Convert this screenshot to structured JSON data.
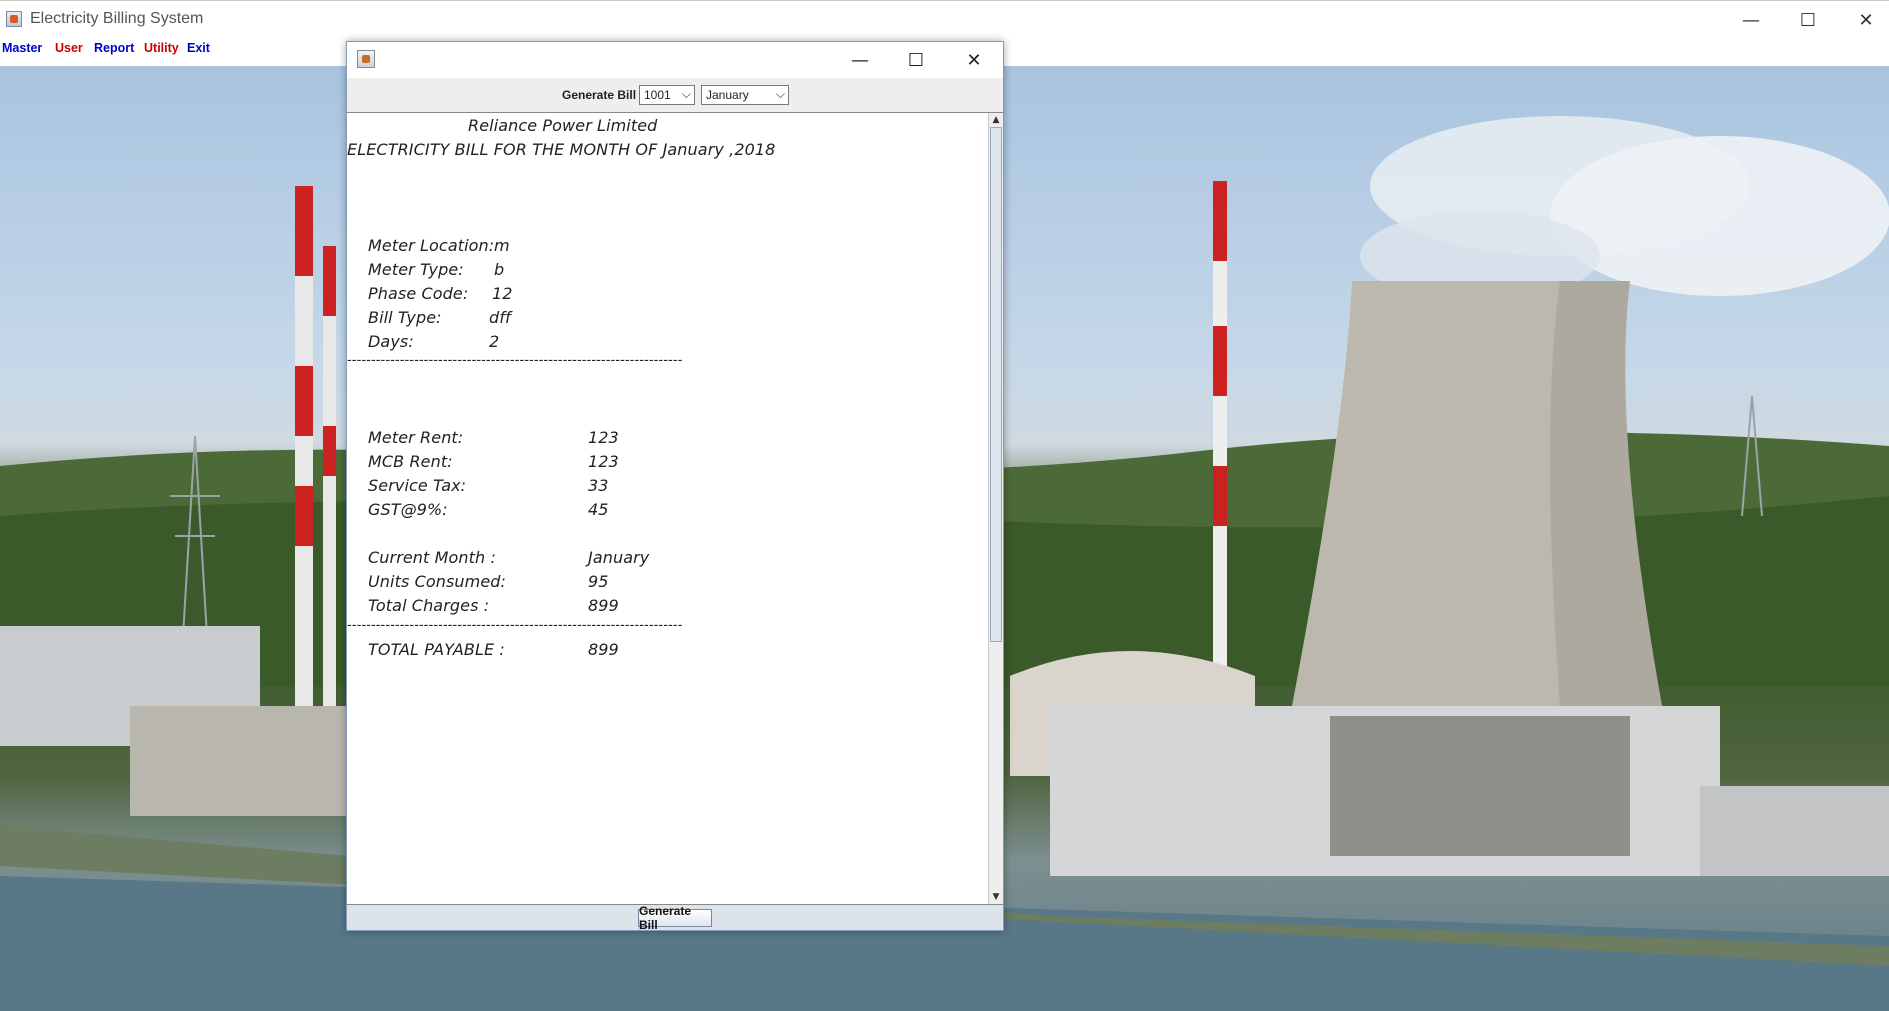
{
  "window": {
    "title": "Electricity Billing System",
    "controls": {
      "minimize": "—",
      "maximize": "☐",
      "close": "✕"
    }
  },
  "menu": {
    "items": [
      {
        "label": "Master",
        "color": "#0000cc"
      },
      {
        "label": "User",
        "color": "#cc0000"
      },
      {
        "label": "Report",
        "color": "#0000cc"
      },
      {
        "label": "Utility",
        "color": "#cc0000"
      },
      {
        "label": "Exit",
        "color": "#0000cc"
      }
    ]
  },
  "dialog": {
    "controls": {
      "minimize": "—",
      "maximize": "☐",
      "close": "✕"
    },
    "toolbar": {
      "label": "Generate Bill",
      "meter_select": "1001",
      "month_select": "January"
    },
    "bill": {
      "company": "Reliance Power Limited",
      "heading": "ELECTRICITY BILL FOR THE MONTH OF January ,2018",
      "meter_location_label": "Meter Location:",
      "meter_location_value": "m",
      "meter_type_label": "Meter Type:",
      "meter_type_value": "b",
      "phase_code_label": "Phase Code:",
      "phase_code_value": "12",
      "bill_type_label": "Bill Type:",
      "bill_type_value": "dff",
      "days_label": "Days:",
      "days_value": "2",
      "separator": "----------------------------------------------------------------------",
      "meter_rent_label": "Meter Rent:",
      "meter_rent_value": "123",
      "mcb_rent_label": "MCB Rent:",
      "mcb_rent_value": "123",
      "service_tax_label": "Service Tax:",
      "service_tax_value": "33",
      "gst_label": "GST@9%:",
      "gst_value": "45",
      "current_month_label": "Current Month :",
      "current_month_value": "January",
      "units_label": "Units Consumed:",
      "units_value": "95",
      "total_charges_label": "Total Charges :",
      "total_charges_value": "899",
      "total_payable_label": "TOTAL PAYABLE :",
      "total_payable_value": "899"
    },
    "button_label": "Generate Bill"
  },
  "icons": {
    "app": "java-app-icon",
    "scroll_up": "▲",
    "scroll_down": "▼",
    "combo_arrow": "⌵"
  }
}
